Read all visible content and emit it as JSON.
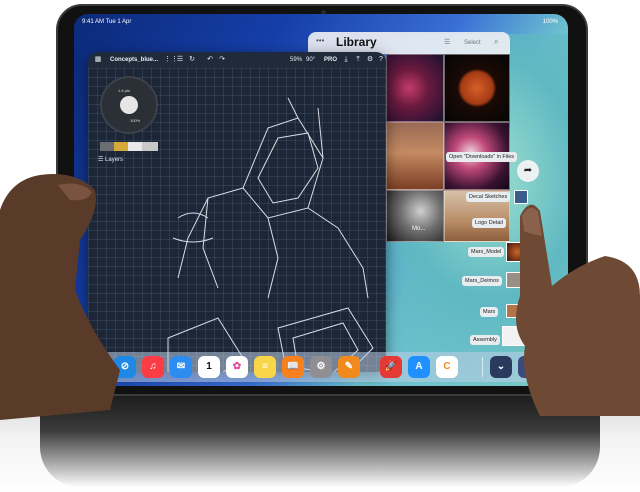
{
  "status": {
    "time": "9:41 AM  Tue 1 Apr",
    "battery": "100%"
  },
  "concepts": {
    "title": "Concepts_blue...",
    "zoom": "59%",
    "angle": "90°",
    "pro": "PRO",
    "layers_label": "Layers",
    "tool_size": "1.6 pts",
    "tool_opacity": "100%",
    "swatches": [
      "#6a6e73",
      "#d4a93a",
      "#e9e9e9",
      "#c9c9c9"
    ]
  },
  "library": {
    "title": "Library",
    "select_label": "Select",
    "caption": "Mo..."
  },
  "drag_items": [
    {
      "label": "Open \"Downloads\" in Files"
    },
    {
      "label": "Decal Sketches"
    },
    {
      "label": "Logo Detail"
    },
    {
      "label": "Mars_Model"
    },
    {
      "label": "Mars_Deimos"
    },
    {
      "label": "Mars"
    },
    {
      "label": "Assembly"
    }
  ],
  "dock": {
    "calendar_day": "1",
    "apps": [
      "messages-icon",
      "safari-icon",
      "music-icon",
      "mail-icon",
      "calendar-icon",
      "photos-icon",
      "notes-icon",
      "books-icon",
      "settings-icon",
      "pencil-app-icon",
      "rocket-app-icon",
      "app-store-icon",
      "concepts-app-icon",
      "more-icon",
      "app-library-icon"
    ]
  },
  "colors": {
    "accent": "#2f6bd8",
    "canvas": "#1c2636"
  }
}
